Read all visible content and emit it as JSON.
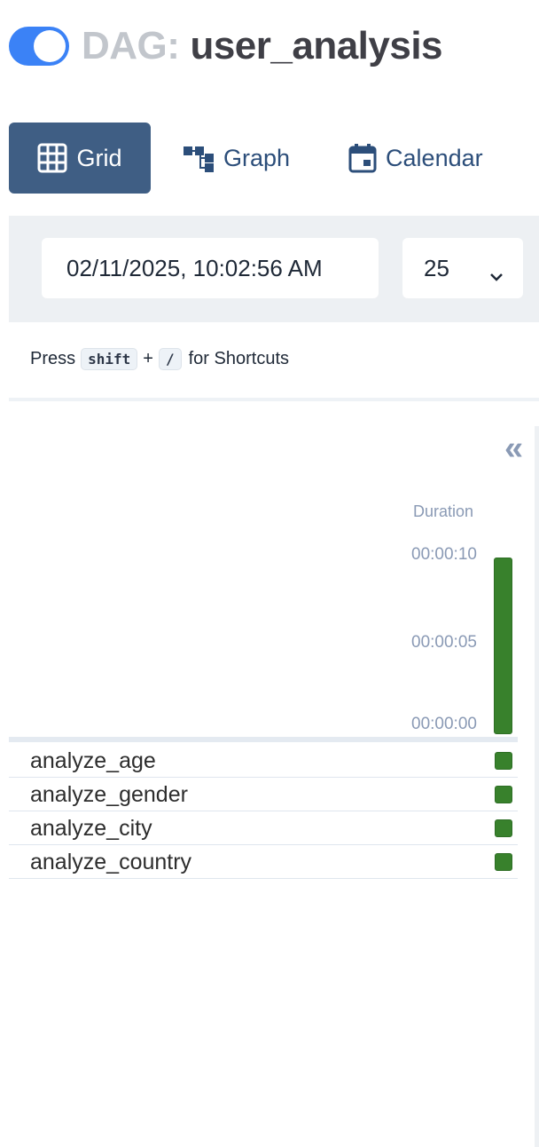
{
  "header": {
    "toggle_on": true,
    "title_prefix": "DAG:",
    "dag_id": "user_analysis"
  },
  "tabs": [
    {
      "label": "Grid",
      "icon": "grid-icon",
      "active": true
    },
    {
      "label": "Graph",
      "icon": "graph-icon",
      "active": false
    },
    {
      "label": "Calendar",
      "icon": "calendar-icon",
      "active": false
    }
  ],
  "filters": {
    "base_date": "02/11/2025, 10:02:56 AM",
    "num_runs": "25"
  },
  "shortcuts": {
    "press": "Press",
    "key1": "shift",
    "plus": "+",
    "key2": "/",
    "suffix": "for Shortcuts"
  },
  "grid": {
    "collapse_label": "«",
    "duration_label": "Duration",
    "ticks": [
      "00:00:10",
      "00:00:05",
      "00:00:00"
    ],
    "run_durations_seconds": [
      10
    ],
    "tasks": [
      {
        "name": "analyze_age",
        "state": "success"
      },
      {
        "name": "analyze_gender",
        "state": "success"
      },
      {
        "name": "analyze_city",
        "state": "success"
      },
      {
        "name": "analyze_country",
        "state": "success"
      }
    ]
  },
  "colors": {
    "accent": "#3b82f6",
    "tab_active": "#3f5e84",
    "success": "#38812c",
    "muted": "#8a9ab5"
  }
}
